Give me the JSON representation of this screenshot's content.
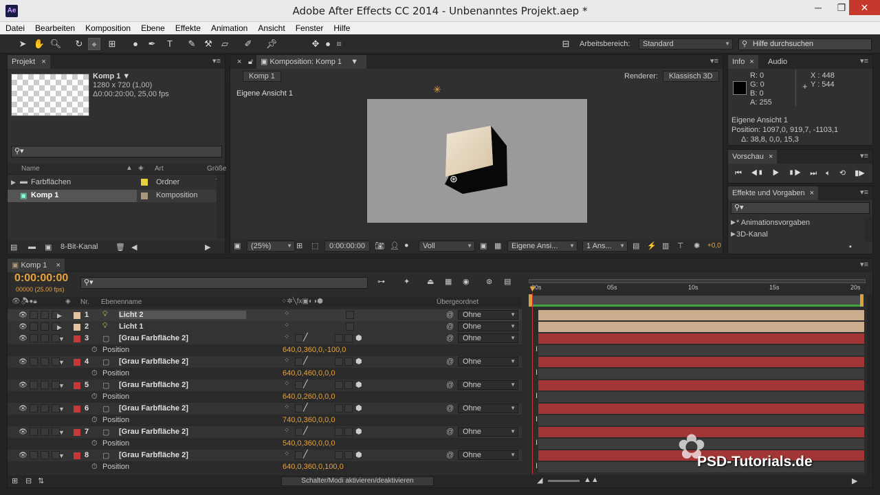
{
  "window": {
    "title": "Adobe After Effects CC 2014 - Unbenanntes Projekt.aep *",
    "app_icon": "Ae"
  },
  "menu": [
    "Datei",
    "Bearbeiten",
    "Komposition",
    "Ebene",
    "Effekte",
    "Animation",
    "Ansicht",
    "Fenster",
    "Hilfe"
  ],
  "toolbar": {
    "workspace_label": "Arbeitsbereich:",
    "workspace_value": "Standard",
    "help_placeholder": "Hilfe durchsuchen"
  },
  "project": {
    "tab": "Projekt",
    "comp_name": "Komp 1 ▼",
    "comp_size": "1280 x 720 (1,00)",
    "comp_duration": "Δ0:00:20:00, 25,00 fps",
    "col_name": "Name",
    "col_type": "Art",
    "col_size": "Größe",
    "items": [
      {
        "name": "Farbflächen",
        "type": "Ordner",
        "color": "#e8d23a"
      },
      {
        "name": "Komp 1",
        "type": "Komposition",
        "color": "#a8977a"
      }
    ],
    "bit_depth": "8-Bit-Kanal"
  },
  "composition": {
    "tab": "Komposition: Komp 1",
    "breadcrumb": "Komp 1",
    "renderer_label": "Renderer:",
    "renderer_value": "Klassisch 3D",
    "view_label": "Eigene Ansicht 1",
    "zoom": "(25%)",
    "timecode": "0:00:00:00",
    "resolution": "Voll",
    "view_select": "Eigene Ansi...",
    "views_count": "1 Ans...",
    "exposure": "+0,0"
  },
  "info": {
    "tab_info": "Info",
    "tab_audio": "Audio",
    "r": "R: 0",
    "g": "G: 0",
    "b": "B: 0",
    "a": "A:  255",
    "x": "X : 448",
    "y": "Y : 544",
    "view": "Eigene Ansicht 1",
    "position": "Position: 1097,0, 919,7, -1103,1",
    "delta": "Δ: 38,8, 0,0, 15,3"
  },
  "preview": {
    "tab": "Vorschau"
  },
  "effects": {
    "tab": "Effekte und Vorgaben",
    "items": [
      "* Animationsvorgaben",
      "3D-Kanal"
    ]
  },
  "timeline": {
    "tab": "Komp 1",
    "timecode": "0:00:00:00",
    "frames": "00000 (25.00 fps)",
    "col_nr": "Nr.",
    "col_name": "Ebenenname",
    "col_parent": "Übergeordnet",
    "ruler": [
      "00s",
      "05s",
      "10s",
      "15s",
      "20s"
    ],
    "toggle_label": "Schalter/Modi aktivieren/deaktivieren",
    "layers": [
      {
        "nr": "1",
        "name": "Licht 2",
        "parent": "Ohne",
        "color": "#e6c4a0",
        "light": true
      },
      {
        "nr": "2",
        "name": "Licht 1",
        "parent": "Ohne",
        "color": "#e6c4a0",
        "light": true
      },
      {
        "nr": "3",
        "name": "[Grau Farbfläche 2]",
        "parent": "Ohne",
        "color": "#c43a3a",
        "pos": "640,0,360,0,-100,0"
      },
      {
        "nr": "4",
        "name": "[Grau Farbfläche 2]",
        "parent": "Ohne",
        "color": "#c43a3a",
        "pos": "640,0,460,0,0,0"
      },
      {
        "nr": "5",
        "name": "[Grau Farbfläche 2]",
        "parent": "Ohne",
        "color": "#c43a3a",
        "pos": "640,0,260,0,0,0"
      },
      {
        "nr": "6",
        "name": "[Grau Farbfläche 2]",
        "parent": "Ohne",
        "color": "#c43a3a",
        "pos": "740,0,360,0,0,0"
      },
      {
        "nr": "7",
        "name": "[Grau Farbfläche 2]",
        "parent": "Ohne",
        "color": "#c43a3a",
        "pos": "540,0,360,0,0,0"
      },
      {
        "nr": "8",
        "name": "[Grau Farbfläche 2]",
        "parent": "Ohne",
        "color": "#c43a3a",
        "pos": "640,0,360,0,100,0"
      }
    ],
    "position_label": "Position"
  },
  "watermark": "PSD-Tutorials.de"
}
